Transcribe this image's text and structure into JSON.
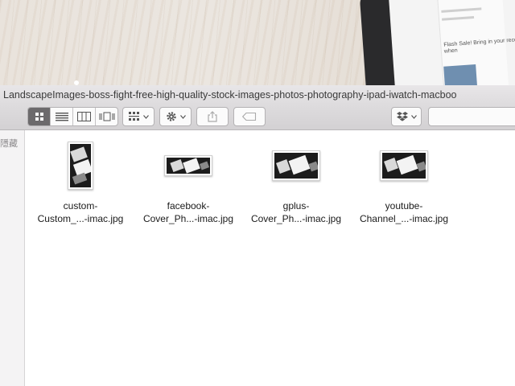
{
  "window": {
    "title": "LandscapeImages-boss-fight-free-high-quality-stock-images-photos-photography-ipad-iwatch-macboo"
  },
  "toolbar": {
    "view_modes": [
      "icon-view",
      "list-view",
      "column-view",
      "cover-flow-view"
    ],
    "active_view": "icon-view",
    "group_icon": "grid-group-icon",
    "action_icon": "gear-icon",
    "share_icon": "share-icon",
    "tag_icon": "tag-icon",
    "dropbox_icon": "dropbox-icon"
  },
  "sidebar": {
    "label": "隱藏"
  },
  "files": [
    {
      "line1": "custom-",
      "line2": "Custom_...-imac.jpg",
      "orientation": "portrait"
    },
    {
      "line1": "facebook-",
      "line2": "Cover_Ph...-imac.jpg",
      "orientation": "wide"
    },
    {
      "line1": "gplus-",
      "line2": "Cover_Ph...-imac.jpg",
      "orientation": "landscape"
    },
    {
      "line1": "youtube-",
      "line2": "Channel_...-imac.jpg",
      "orientation": "landscape"
    }
  ],
  "desktop": {
    "device_text": "Flash Sale! Bring in your receipt when"
  }
}
